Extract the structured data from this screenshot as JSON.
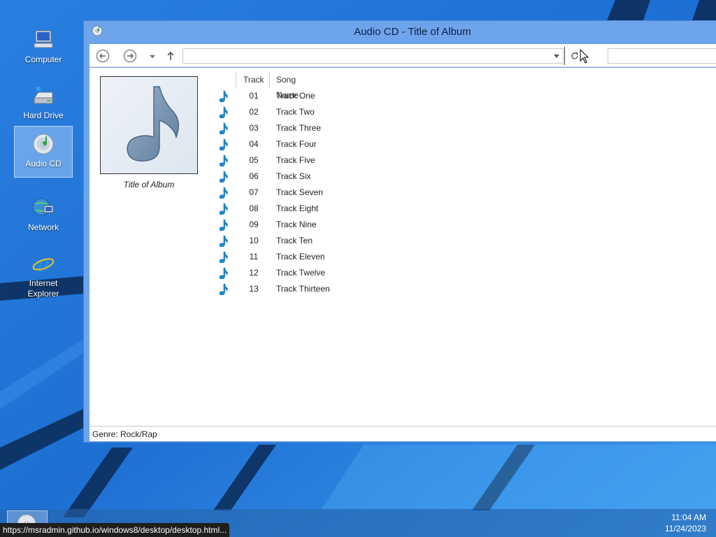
{
  "desktop": {
    "icons": [
      {
        "label": "Computer"
      },
      {
        "label": "Hard Drive"
      },
      {
        "label": "Audio CD"
      },
      {
        "label": "Network"
      },
      {
        "label": "Internet Explorer"
      }
    ]
  },
  "window": {
    "title": "Audio CD - Title of Album",
    "address_value": "",
    "search_value": ""
  },
  "album": {
    "caption": "Title of Album"
  },
  "table": {
    "columns": [
      "Track",
      "Song Name"
    ],
    "rows": [
      {
        "num": "01",
        "name": "Track One"
      },
      {
        "num": "02",
        "name": "Track Two"
      },
      {
        "num": "03",
        "name": "Track Three"
      },
      {
        "num": "04",
        "name": "Track Four"
      },
      {
        "num": "05",
        "name": "Track Five"
      },
      {
        "num": "06",
        "name": "Track Six"
      },
      {
        "num": "07",
        "name": "Track Seven"
      },
      {
        "num": "08",
        "name": "Track Eight"
      },
      {
        "num": "09",
        "name": "Track Nine"
      },
      {
        "num": "10",
        "name": "Track Ten"
      },
      {
        "num": "11",
        "name": "Track Eleven"
      },
      {
        "num": "12",
        "name": "Track Twelve"
      },
      {
        "num": "13",
        "name": "Track Thirteen"
      }
    ]
  },
  "status": {
    "genre": "Genre: Rock/Rap"
  },
  "taskbar": {
    "time": "11:04 AM",
    "date": "11/24/2023",
    "url_tooltip": "https://msradmin.github.io/windows8/desktop/desktop.html..."
  },
  "colors": {
    "wallpaper": "#1f6fd0",
    "window_frame": "#6ea4ec",
    "note_icon": "#1a8fd6"
  }
}
